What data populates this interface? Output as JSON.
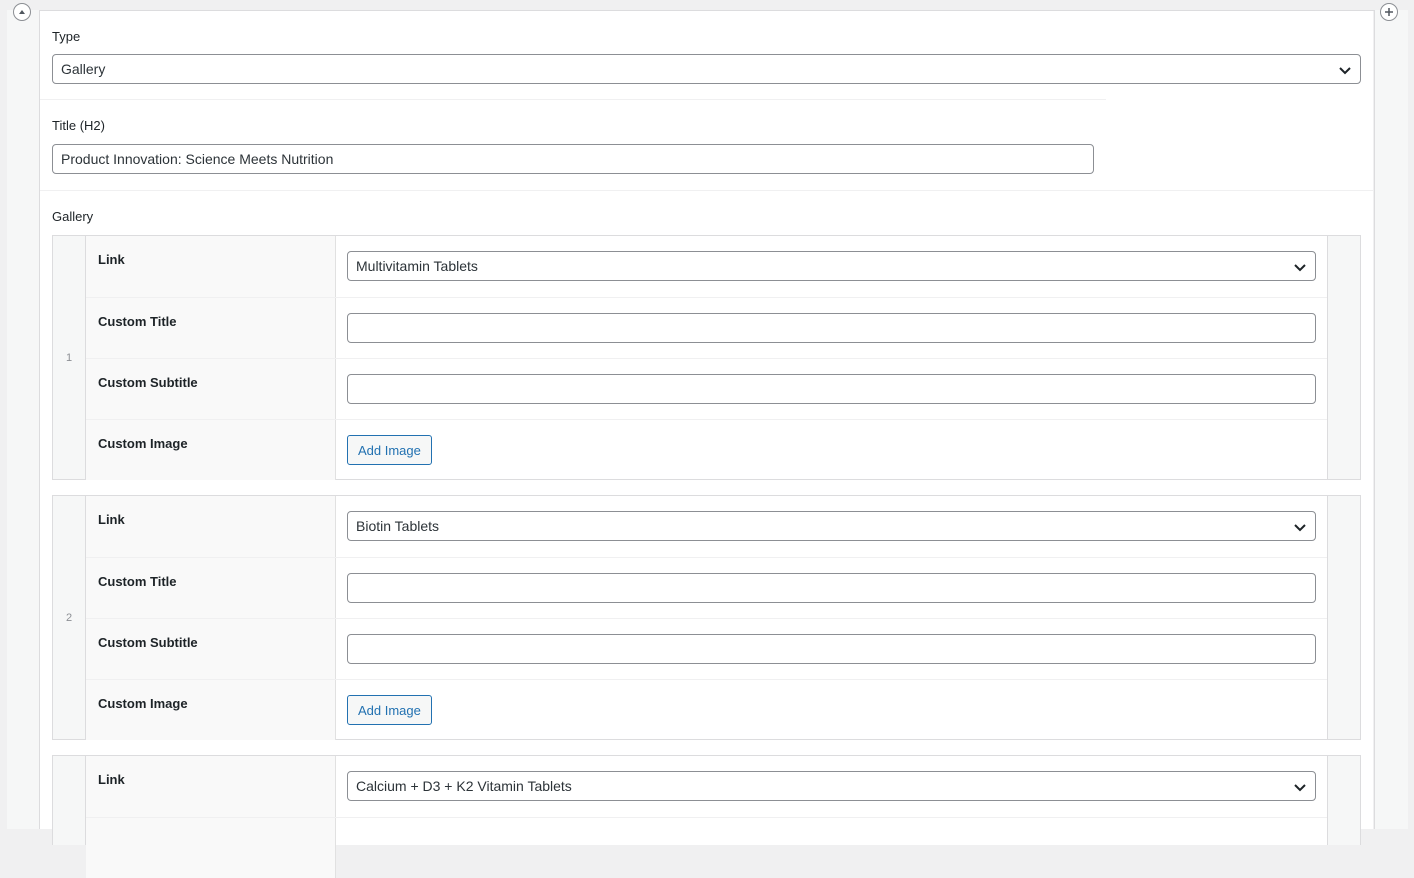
{
  "fields": {
    "type": {
      "label": "Type",
      "value": "Gallery"
    },
    "title": {
      "label": "Title (H2)",
      "value": "Product Innovation: Science Meets Nutrition"
    },
    "gallery": {
      "label": "Gallery"
    }
  },
  "gallery_rows": [
    {
      "index": "1",
      "link_label": "Link",
      "link_value": "Multivitamin Tablets",
      "custom_title_label": "Custom Title",
      "custom_title_value": "",
      "custom_subtitle_label": "Custom Subtitle",
      "custom_subtitle_value": "",
      "custom_image_label": "Custom Image",
      "add_image_label": "Add Image"
    },
    {
      "index": "2",
      "link_label": "Link",
      "link_value": "Biotin Tablets",
      "custom_title_label": "Custom Title",
      "custom_title_value": "",
      "custom_subtitle_label": "Custom Subtitle",
      "custom_subtitle_value": "",
      "custom_image_label": "Custom Image",
      "add_image_label": "Add Image"
    },
    {
      "index": "",
      "link_label": "Link",
      "link_value": "Calcium + D3 + K2 Vitamin Tablets"
    }
  ],
  "icons": {
    "collapse": "collapse-arrow-icon",
    "add": "plus-circle-icon",
    "chevron": "chevron-down-icon"
  }
}
